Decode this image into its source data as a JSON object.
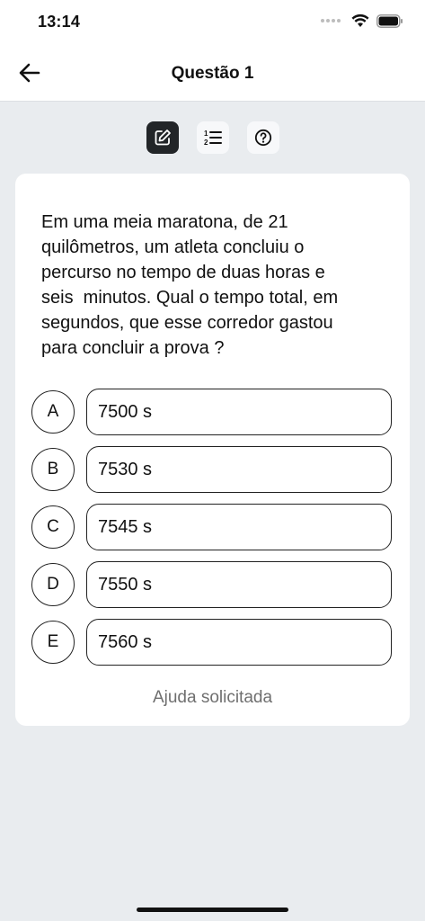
{
  "status_bar": {
    "time": "13:14"
  },
  "header": {
    "title": "Questão 1"
  },
  "toolbar": {
    "items": [
      {
        "icon": "edit-icon",
        "active": true
      },
      {
        "icon": "numbered-list-icon",
        "active": false
      },
      {
        "icon": "help-icon",
        "active": false
      }
    ]
  },
  "question": {
    "text": "Em uma meia maratona, de 21\nquilômetros, um atleta concluiu o\npercurso no tempo de duas horas e\nseis  minutos. Qual o tempo total, em\nsegundos, que esse corredor gastou\npara concluir a prova ?"
  },
  "options": [
    {
      "letter": "A",
      "value": "7500 s"
    },
    {
      "letter": "B",
      "value": "7530 s"
    },
    {
      "letter": "C",
      "value": "7545 s"
    },
    {
      "letter": "D",
      "value": "7550 s"
    },
    {
      "letter": "E",
      "value": "7560 s"
    }
  ],
  "help": {
    "label": "Ajuda solicitada"
  },
  "colors": {
    "background": "#e9ecef",
    "card": "#ffffff",
    "active_tool": "#222528",
    "muted_text": "#6f6f6f"
  }
}
